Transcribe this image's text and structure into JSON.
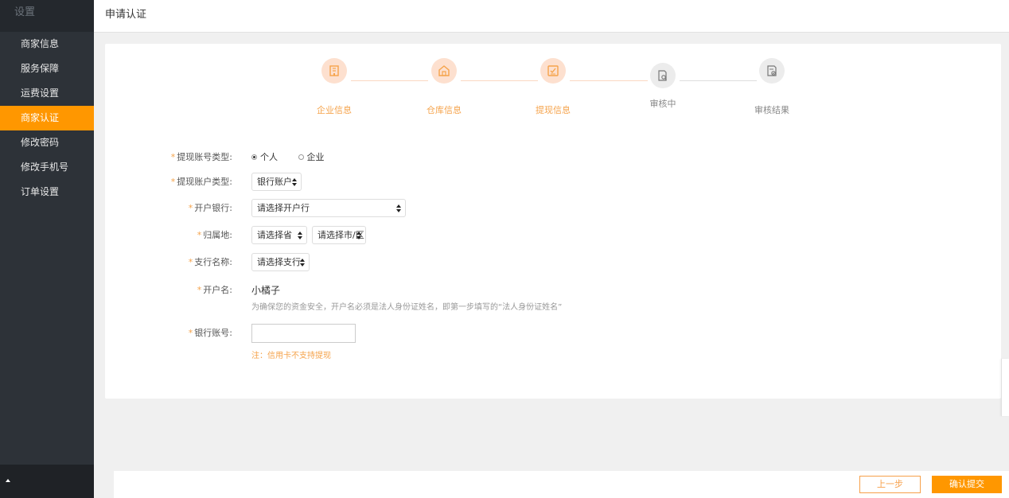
{
  "sidebar": {
    "header": "设置",
    "items": [
      {
        "label": "商家信息",
        "active": false
      },
      {
        "label": "服务保障",
        "active": false
      },
      {
        "label": "运费设置",
        "active": false
      },
      {
        "label": "商家认证",
        "active": true
      },
      {
        "label": "修改密码",
        "active": false
      },
      {
        "label": "修改手机号",
        "active": false
      },
      {
        "label": "订单设置",
        "active": false
      }
    ]
  },
  "header": {
    "title": "申请认证"
  },
  "steps": [
    {
      "label": "企业信息",
      "status": "done",
      "icon": "building-icon"
    },
    {
      "label": "仓库信息",
      "status": "done",
      "icon": "warehouse-icon"
    },
    {
      "label": "提现信息",
      "status": "done",
      "icon": "checklist-icon"
    },
    {
      "label": "审核中",
      "status": "todo",
      "icon": "document-search-icon"
    },
    {
      "label": "审核结果",
      "status": "todo",
      "icon": "document-check-icon"
    }
  ],
  "form": {
    "account_type": {
      "label": "提现账号类型:",
      "options": [
        "个人",
        "企业"
      ],
      "selected": "个人"
    },
    "account_kind": {
      "label": "提现账户类型:",
      "value": "银行账户"
    },
    "bank": {
      "label": "开户银行:",
      "value": "请选择开户行"
    },
    "location": {
      "label": "归属地:",
      "province": "请选择省",
      "city": "请选择市/区"
    },
    "branch": {
      "label": "支行名称:",
      "value": "请选择支行"
    },
    "holder": {
      "label": "开户名:",
      "value": "小橘子",
      "hint": "为确保您的资金安全，开户名必须是法人身份证姓名，即第一步填写的“法人身份证姓名”"
    },
    "bank_no": {
      "label": "银行账号:",
      "value": "",
      "note": "注：信用卡不支持提现"
    }
  },
  "footer": {
    "prev_label": "上一步",
    "submit_label": "确认提交"
  },
  "colors": {
    "accent": "#ff9700",
    "sidebar_bg": "#2d3238",
    "step_done_bg": "#fde0cf",
    "step_done_text": "#f5a34b"
  }
}
